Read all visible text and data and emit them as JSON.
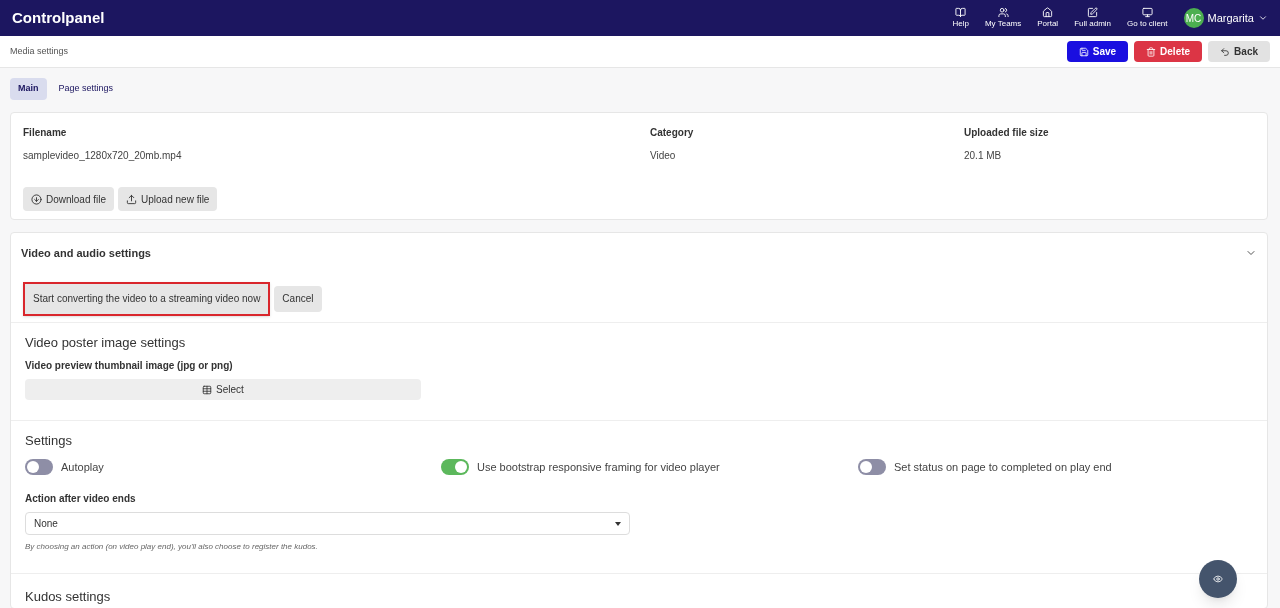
{
  "app": {
    "title": "Controlpanel"
  },
  "nav": [
    {
      "label": "Help",
      "kind": "book"
    },
    {
      "label": "My Teams",
      "kind": "users"
    },
    {
      "label": "Portal",
      "kind": "home"
    },
    {
      "label": "Full admin",
      "kind": "edit"
    },
    {
      "label": "Go to client",
      "kind": "monitor"
    }
  ],
  "user": {
    "initials": "MC",
    "name": "Margarita"
  },
  "page": {
    "title": "Media settings"
  },
  "actions": [
    {
      "label": "Save",
      "kind": "save"
    },
    {
      "label": "Delete",
      "kind": "delete"
    },
    {
      "label": "Back",
      "kind": "back"
    }
  ],
  "tabs": [
    {
      "label": "Main",
      "selected": true
    },
    {
      "label": "Page settings",
      "selected": false
    }
  ],
  "file": {
    "columns": [
      {
        "heading": "Filename",
        "value": "samplevideo_1280x720_20mb.mp4"
      },
      {
        "heading": "Category",
        "value": "Video"
      },
      {
        "heading": "Uploaded file size",
        "value": "20.1 MB"
      }
    ],
    "buttons": [
      {
        "label": "Download file",
        "kind": "download"
      },
      {
        "label": "Upload new file",
        "kind": "upload"
      }
    ]
  },
  "video_section": {
    "title": "Video and audio settings",
    "expanded": true,
    "convert_button": "Start converting the video to a streaming video now",
    "cancel_button": "Cancel",
    "poster_title": "Video poster image settings",
    "thumbnail_label": "Video preview thumbnail image (jpg or png)",
    "select_button": "Select",
    "settings_title": "Settings",
    "toggles": [
      {
        "label": "Autoplay",
        "on": false
      },
      {
        "label": "Use bootstrap responsive framing for video player",
        "on": true
      },
      {
        "label": "Set status on page to completed on play end",
        "on": false
      }
    ],
    "action_label": "Action after video ends",
    "action_value": "None",
    "action_help": "By choosing an action (on video play end), you'll also choose to register the kudos.",
    "kudos_title": "Kudos settings"
  }
}
